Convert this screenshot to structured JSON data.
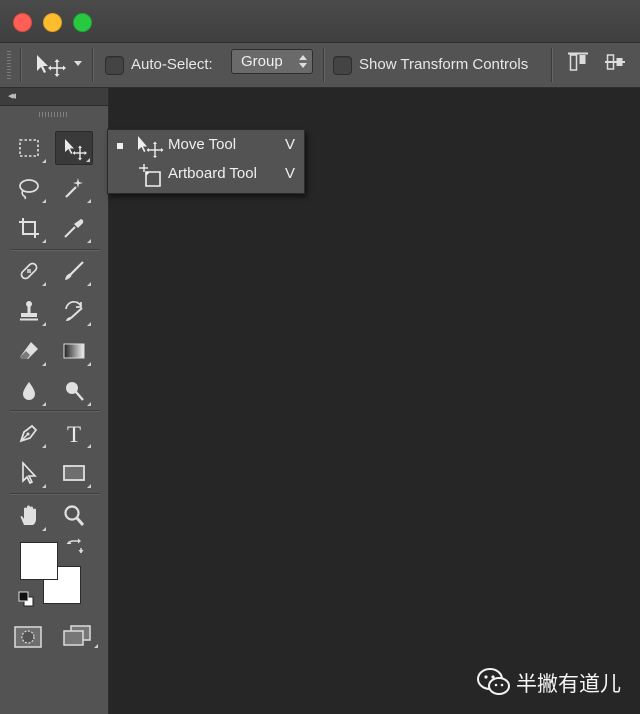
{
  "window": {
    "controls": {
      "close_color": "#fd5f57",
      "minimize_color": "#febc2e",
      "zoom_color": "#28c840"
    }
  },
  "options_bar": {
    "tool_icon": "move-tool-icon",
    "auto_select": {
      "label": "Auto-Select:",
      "checked": false
    },
    "auto_select_target": {
      "selected": "Group"
    },
    "show_transform_controls": {
      "label": "Show Transform Controls",
      "checked": false
    },
    "align_icons": [
      "align-top-edges-icon",
      "align-vertical-centers-icon"
    ]
  },
  "tools_panel": {
    "tools": [
      {
        "name": "rectangular-marquee-tool",
        "icon": "rectangular-marquee-icon"
      },
      {
        "name": "move-tool",
        "icon": "move-tool-icon",
        "active": true
      },
      {
        "name": "lasso-tool",
        "icon": "lasso-icon"
      },
      {
        "name": "magic-wand-tool",
        "icon": "magic-wand-icon"
      },
      {
        "name": "crop-tool",
        "icon": "crop-icon"
      },
      {
        "name": "eyedropper-tool",
        "icon": "eyedropper-icon"
      },
      {
        "name": "spot-healing-brush-tool",
        "icon": "bandage-icon"
      },
      {
        "name": "brush-tool",
        "icon": "brush-icon"
      },
      {
        "name": "clone-stamp-tool",
        "icon": "stamp-icon"
      },
      {
        "name": "history-brush-tool",
        "icon": "history-brush-icon"
      },
      {
        "name": "eraser-tool",
        "icon": "eraser-icon"
      },
      {
        "name": "gradient-tool",
        "icon": "gradient-icon"
      },
      {
        "name": "blur-tool",
        "icon": "drop-icon"
      },
      {
        "name": "dodge-tool",
        "icon": "dodge-icon"
      },
      {
        "name": "pen-tool",
        "icon": "pen-icon"
      },
      {
        "name": "type-tool",
        "icon": "type-icon",
        "glyph": "T"
      },
      {
        "name": "path-selection-tool",
        "icon": "path-selection-icon"
      },
      {
        "name": "rectangle-tool",
        "icon": "rectangle-icon"
      },
      {
        "name": "hand-tool",
        "icon": "hand-icon"
      },
      {
        "name": "zoom-tool",
        "icon": "zoom-icon"
      }
    ],
    "foreground_color": "#ffffff",
    "background_color": "#ffffff"
  },
  "flyout_menu": {
    "items": [
      {
        "label": "Move Tool",
        "shortcut": "V",
        "selected": true,
        "icon": "move-tool-icon"
      },
      {
        "label": "Artboard Tool",
        "shortcut": "V",
        "selected": false,
        "icon": "artboard-tool-icon"
      }
    ]
  },
  "watermark": {
    "text": "半撇有道儿",
    "icon": "wechat-icon"
  },
  "colors": {
    "canvas": "#262626",
    "panel": "#535353",
    "titlebar": "#444444"
  }
}
